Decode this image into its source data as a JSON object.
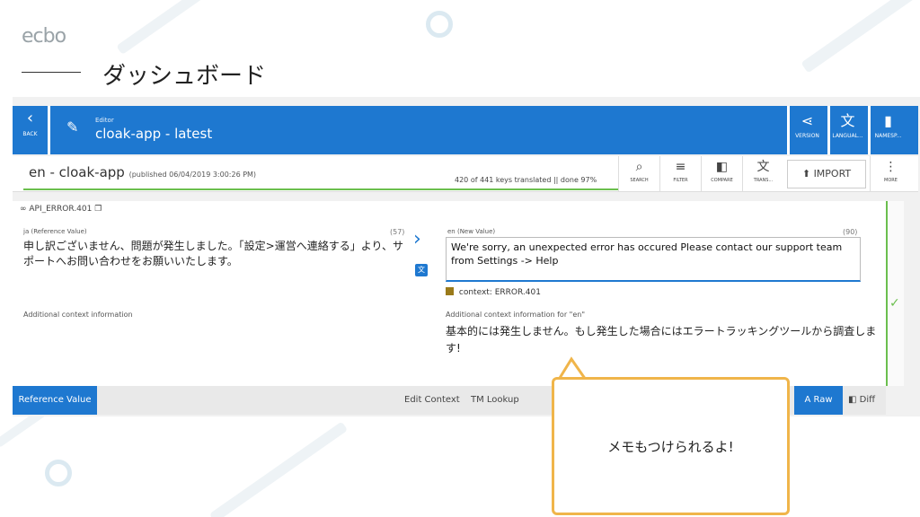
{
  "logo": "ecbo",
  "page_title": "ダッシュボード",
  "topbar": {
    "back_label": "BACK",
    "editor_small": "Editor",
    "editor_name": "cloak-app - latest",
    "right_buttons": [
      {
        "label": "VERSION",
        "icon": "share-icon"
      },
      {
        "label": "LANGUAL...",
        "icon": "translate-icon"
      },
      {
        "label": "NAMESP...",
        "icon": "file-icon"
      }
    ]
  },
  "toolbar": {
    "locale_title": "en - cloak-app",
    "published": "(published 06/04/2019 3:00:26 PM)",
    "progress": "420 of 441 keys translated || done 97%",
    "tools": [
      {
        "label": "SEARCH",
        "icon": "search-icon"
      },
      {
        "label": "FILTER",
        "icon": "filter-icon"
      },
      {
        "label": "COMPARE",
        "icon": "compare-icon"
      },
      {
        "label": "TRANS...",
        "icon": "translate-icon"
      }
    ],
    "import_label": "IMPORT",
    "more_label": "MORE"
  },
  "content": {
    "key_name": "API_ERROR.401",
    "ref_label": "ja (Reference Value)",
    "ref_count": "(57)",
    "ref_text": "申し訳ございません、問題が発生しました。「設定>運営へ連絡する」より、サポートへお問い合わせをお願いいたします。",
    "ref_additional": "Additional context information",
    "en_label": "en (New Value)",
    "en_count": "(90)",
    "en_value": "We're sorry, an unexpected error has occured Please contact our support team from Settings -> Help",
    "context": "context: ERROR.401",
    "en_additional": "Additional context information for \"en\"",
    "en_additional_text": "基本的には発生しません。もし発生した場合にはエラートラッキングツールから調査します!"
  },
  "bottombar": {
    "reference_tab": "Reference Value",
    "edit_context": "Edit Context",
    "tm_lookup": "TM Lookup",
    "raw": "Raw",
    "diff": "Diff"
  },
  "callout": {
    "text": "メモもつけられるよ!"
  },
  "colors": {
    "primary": "#1e78d0",
    "success": "#6bbf4e",
    "callout_border": "#f0b54a"
  }
}
